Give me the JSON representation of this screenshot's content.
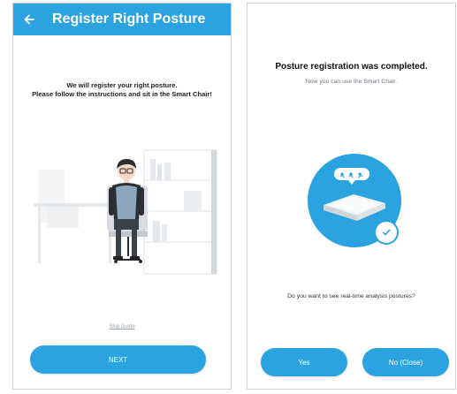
{
  "register": {
    "title": "Register Right Posture",
    "intro_line1": "We will register your right posture.",
    "intro_line2": "Please follow the instructions and sit in the Smart Chair!",
    "skip_label": "Skip Guide",
    "next_label": "NEXT"
  },
  "complete": {
    "title": "Posture registration was completed.",
    "subtitle": "Now you can use the Smart Chair.",
    "question": "Do you want to see real-time analysis postures?",
    "yes_label": "Yes",
    "no_label": "No (Close)"
  },
  "icons": {
    "back": "back-arrow-icon",
    "check": "check-icon",
    "chair": "smart-chair-cushion-icon"
  },
  "colors": {
    "primary": "#2aa3e0",
    "text": "#222222",
    "muted": "#9aa3ab"
  }
}
